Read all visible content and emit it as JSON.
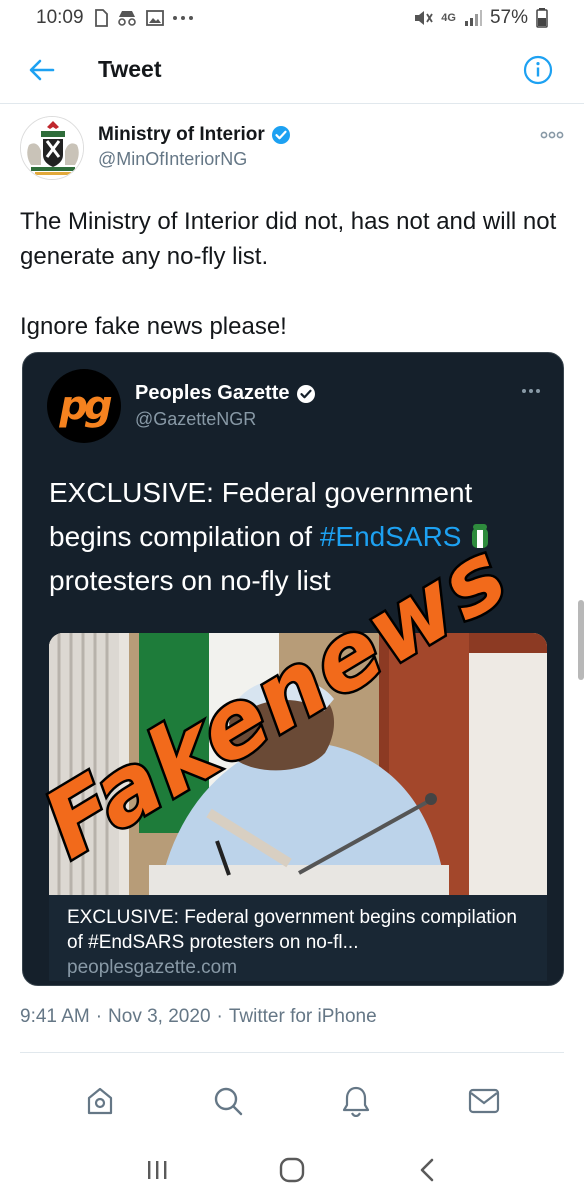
{
  "status_bar": {
    "time": "10:09",
    "signal_label": "4G",
    "battery": "57%"
  },
  "header": {
    "title": "Tweet"
  },
  "tweet": {
    "author_name": "Ministry of Interior",
    "author_handle": "@MinOfInteriorNG",
    "text_1": "The Ministry of Interior did not, has not and will not generate any no-fly list.",
    "text_2": "Ignore fake news please!",
    "time": "9:41 AM",
    "date": "Nov 3, 2020",
    "client": "Twitter for iPhone",
    "separator": "·"
  },
  "quoted": {
    "avatar_text": "pg",
    "author_name": "Peoples Gazette",
    "author_handle": "@GazetteNGR",
    "text_before": "EXCLUSIVE: Federal government begins compilation of ",
    "hashtag": "#EndSARS",
    "text_after": " protesters on no-fly list",
    "link_title": "EXCLUSIVE: Federal government begins compilation of #EndSARS protesters on no-fl...",
    "link_domain": "peoplesgazette.com"
  },
  "overlay": {
    "text": "Fakenews"
  },
  "colors": {
    "accent": "#1da1f2",
    "card_bg": "#15202b",
    "overlay_fill": "#f26a1b"
  },
  "icons": {
    "back": "arrow-left-icon",
    "info": "info-icon",
    "more": "more-dots-icon",
    "verified": "verified-badge-icon",
    "tabs": [
      "home-icon",
      "search-icon",
      "notifications-bell-icon",
      "messages-envelope-icon"
    ],
    "android": [
      "recents-icon",
      "home-circle-icon",
      "back-chevron-icon"
    ]
  }
}
